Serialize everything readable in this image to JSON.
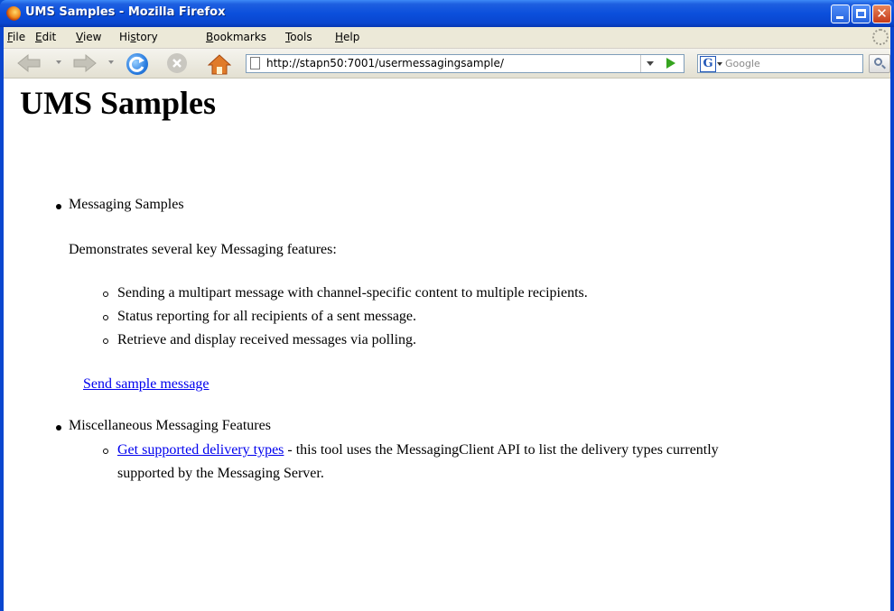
{
  "window": {
    "title": "UMS Samples - Mozilla Firefox"
  },
  "menubar": {
    "items": [
      {
        "accel": "F",
        "rest": "ile"
      },
      {
        "accel": "E",
        "rest": "dit"
      },
      {
        "accel": "V",
        "rest": "iew"
      },
      {
        "pre": "Hi",
        "accel": "s",
        "rest": "tory"
      },
      {
        "accel": "B",
        "rest": "ookmarks"
      },
      {
        "accel": "T",
        "rest": "ools"
      },
      {
        "accel": "H",
        "rest": "elp"
      }
    ]
  },
  "navbar": {
    "url": "http://stapn50:7001/usermessagingsample/",
    "search_placeholder": "Google",
    "search_engine_letter": "G"
  },
  "page": {
    "title": "UMS Samples",
    "section1": {
      "label": "Messaging Samples",
      "description": "Demonstrates several key Messaging features:",
      "features": [
        "Sending a multipart message with channel-specific content to multiple recipients.",
        "Status reporting for all recipients of a sent message.",
        "Retrieve and display received messages via polling."
      ],
      "link_text": "Send sample message"
    },
    "section2": {
      "label": "Miscellaneous Messaging Features",
      "link_text": "Get supported delivery types",
      "desc_line1": " - this tool uses the MessagingClient API to list the delivery types currently",
      "desc_line2": "supported by the Messaging Server."
    }
  }
}
